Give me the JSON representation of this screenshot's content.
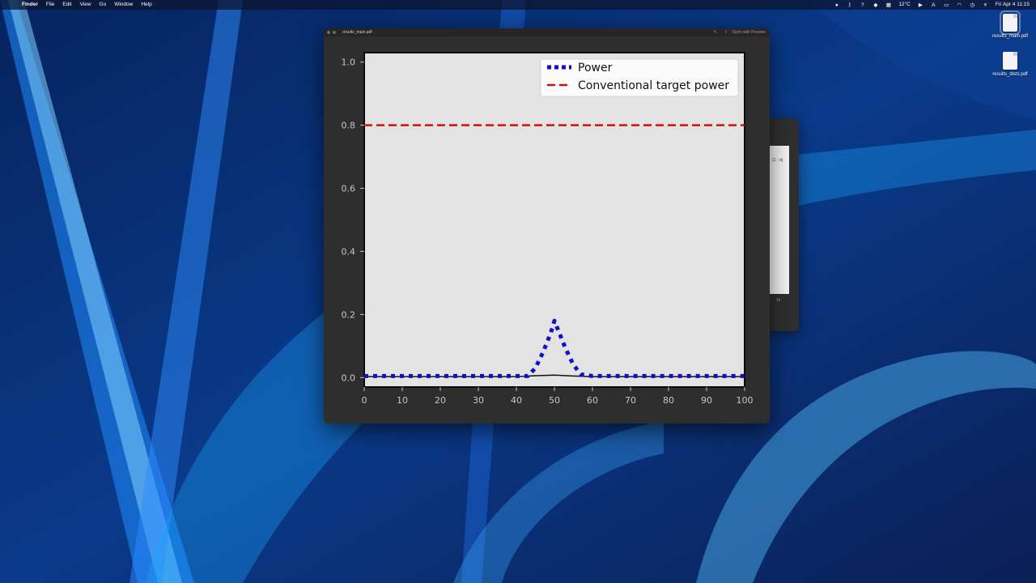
{
  "menubar": {
    "apple_glyph": "",
    "app_name": "Finder",
    "menus": [
      "File",
      "Edit",
      "View",
      "Go",
      "Window",
      "Help"
    ],
    "status_icons": [
      "record-icon",
      "bluetooth-icon",
      "help-icon",
      "dropbox-icon",
      "grid-icon"
    ],
    "weather_text": "12°C",
    "date_time": "Fri Apr 4  11:15"
  },
  "desktop_files": [
    {
      "name": "results_main.pdf",
      "selected": true
    },
    {
      "name": "results_dists.pdf",
      "selected": false
    }
  ],
  "back_window": {
    "fragment_text": "(1 - α)",
    "page_number": "1k"
  },
  "preview_window": {
    "title": "results_main.pdf",
    "open_with": "Open with Preview"
  },
  "chart_data": {
    "type": "line",
    "x_ticks": [
      "0",
      "10",
      "20",
      "30",
      "40",
      "50",
      "60",
      "70",
      "80",
      "90",
      "100"
    ],
    "y_ticks": [
      "0.0",
      "0.2",
      "0.4",
      "0.6",
      "0.8",
      "1.0"
    ],
    "xlim": [
      0,
      100
    ],
    "ylim": [
      -0.03,
      1.03
    ],
    "grid": false,
    "legend_position": "top-right",
    "legend": [
      "Power",
      "Conventional target power"
    ],
    "series": [
      {
        "name": "Power",
        "color": "#1010c8",
        "style": "dotted",
        "x": [
          0,
          10,
          20,
          30,
          40,
          43,
          45,
          47,
          49,
          50,
          51,
          53,
          55,
          57,
          60,
          70,
          80,
          90,
          100
        ],
        "y": [
          0.005,
          0.005,
          0.005,
          0.005,
          0.005,
          0.005,
          0.03,
          0.08,
          0.14,
          0.18,
          0.15,
          0.09,
          0.04,
          0.01,
          0.005,
          0.005,
          0.005,
          0.005,
          0.005
        ]
      },
      {
        "name": "Conventional target power",
        "color": "#d01010",
        "style": "dashed",
        "x": [
          0,
          100
        ],
        "y": [
          0.8,
          0.8
        ]
      },
      {
        "name": "",
        "color": "#111111",
        "style": "solid",
        "x": [
          0,
          40,
          45,
          50,
          55,
          60,
          100
        ],
        "y": [
          0.003,
          0.003,
          0.006,
          0.008,
          0.005,
          0.003,
          0.003
        ]
      }
    ]
  },
  "colors": {
    "plot_background": "#e3e3e3",
    "window_background": "#2e2e2e"
  }
}
